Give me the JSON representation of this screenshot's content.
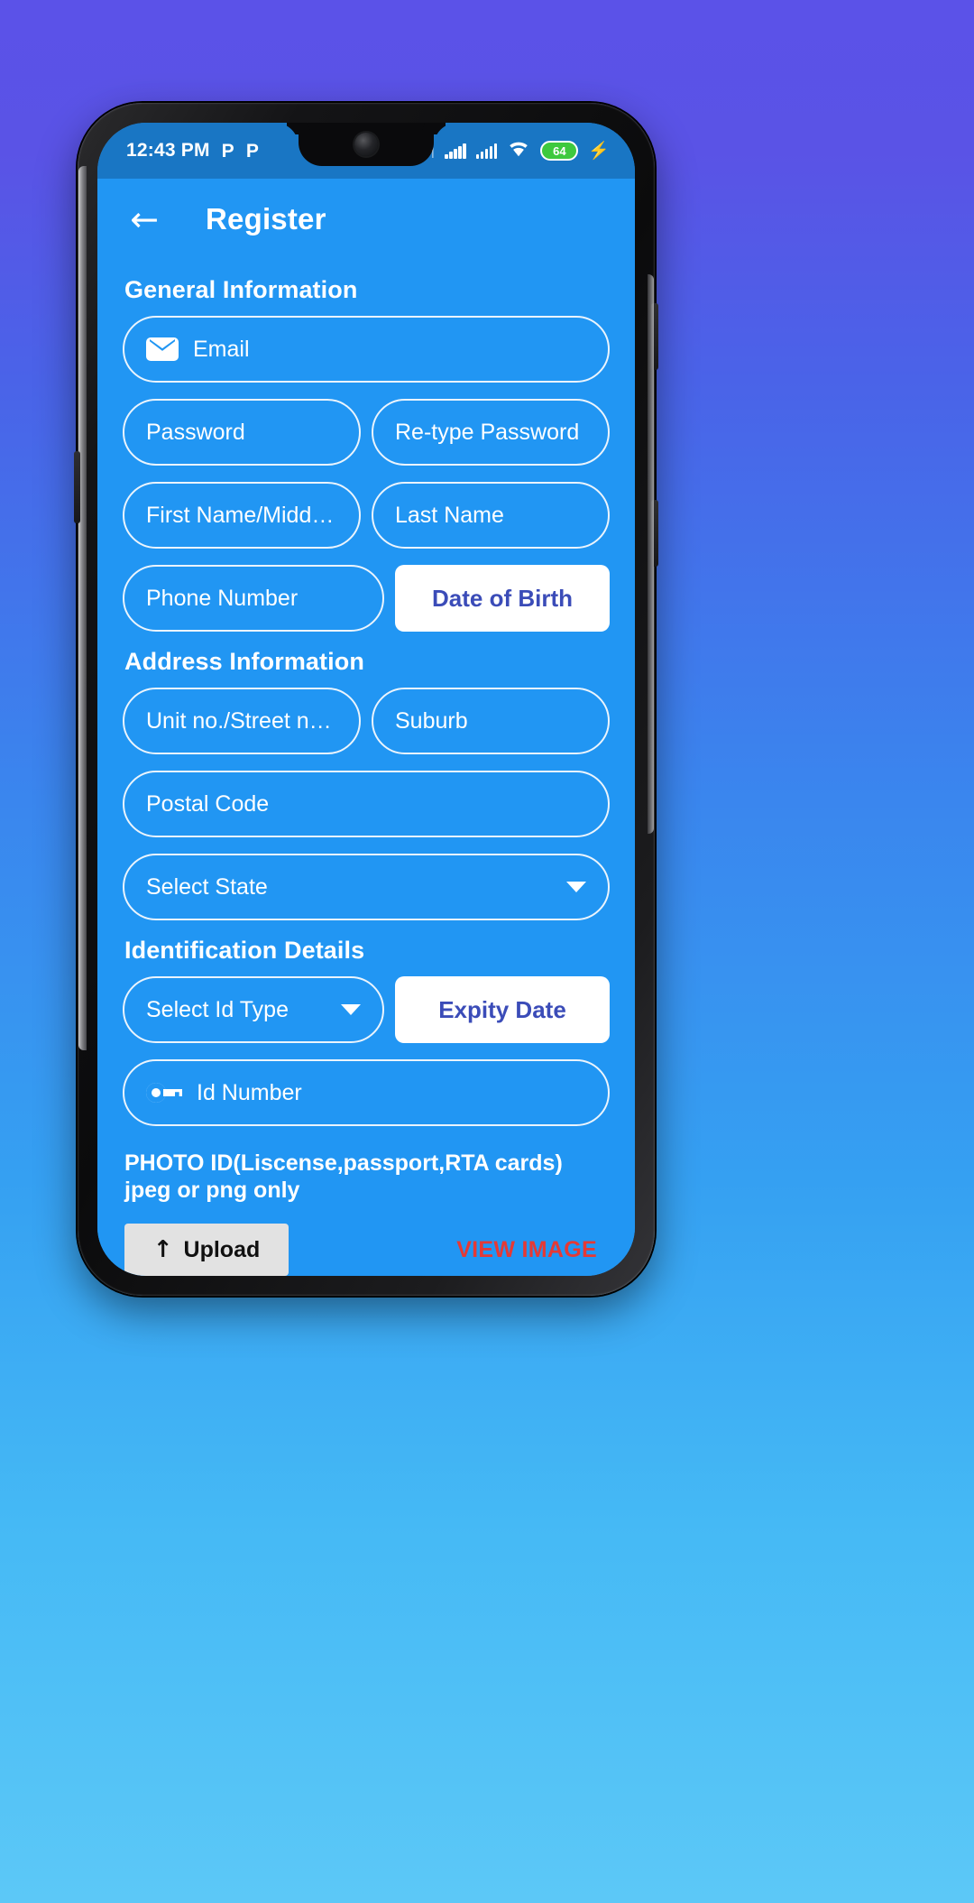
{
  "status_bar": {
    "time": "12:43 PM",
    "left_icons": [
      {
        "name": "p-app-icon-1",
        "glyph": "P"
      },
      {
        "name": "p-app-icon-2",
        "glyph": "P"
      }
    ],
    "bluetooth_glyph": "ᛗ",
    "signal_1_label": "signal-bars-sim1",
    "signal_2_label": "signal-bars-sim2",
    "wifi_label": "wifi-icon",
    "battery_percent": "64",
    "battery_color": "#3ec93e",
    "charging_glyph": "⚡"
  },
  "appbar": {
    "back_glyph": "←",
    "title": "Register"
  },
  "sections": {
    "general": {
      "title": "General Information",
      "email_placeholder": "Email",
      "password_placeholder": "Password",
      "retype_password_placeholder": "Re-type Password",
      "first_name_placeholder": "First Name/Middle ...",
      "last_name_placeholder": "Last Name",
      "phone_placeholder": "Phone Number",
      "dob_button_label": "Date of Birth"
    },
    "address": {
      "title": "Address Information",
      "street_placeholder": "Unit no./Street no./...",
      "suburb_placeholder": "Suburb",
      "postal_placeholder": "Postal Code",
      "state_select_value": "Select State"
    },
    "identification": {
      "title": "Identification Details",
      "id_type_select_value": "Select Id Type",
      "expiry_button_label": "Expity Date",
      "id_number_placeholder": "Id Number",
      "photo_id_helper": "PHOTO ID(Liscense,passport,RTA cards) jpeg or png only",
      "upload_button_label": "Upload",
      "upload_glyph": "↑",
      "view_image_label": "VIEW IMAGE"
    }
  },
  "colors": {
    "app_blue": "#2196f3",
    "status_bar_blue": "#1976c4",
    "button_text_indigo": "#3b4cb8",
    "link_red": "#e53935"
  }
}
